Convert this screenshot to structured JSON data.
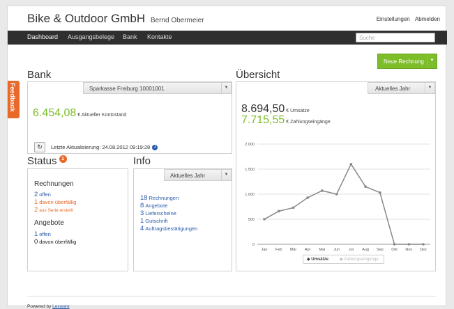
{
  "header": {
    "company": "Bike & Outdoor GmbH",
    "owner": "Bernd Obermeier",
    "settings_label": "Einstellungen",
    "logout_label": "Abmelden"
  },
  "nav": {
    "items": [
      {
        "label": "Dashboard"
      },
      {
        "label": "Ausgangsbelege"
      },
      {
        "label": "Bank"
      },
      {
        "label": "Kontakte"
      }
    ],
    "search_placeholder": "Suche"
  },
  "actions": {
    "new_invoice": "Neue Rechnung"
  },
  "feedback": {
    "label": "Feedback"
  },
  "bank": {
    "title": "Bank",
    "account": "Sparkasse Freiburg 10001001",
    "balance": "6.454,08",
    "balance_label": "€ Aktueller Kontostand",
    "last_update": "Letzte Aktualisierung: 24.08.2012 09:19:28"
  },
  "status": {
    "title": "Status",
    "badge": "1",
    "invoices": {
      "heading": "Rechnungen",
      "open_count": "2",
      "open_label": "offen",
      "overdue_count": "1",
      "overdue_label": "davon überfällig",
      "recurring_count": "2",
      "recurring_label": "aus Serie erstellt"
    },
    "offers": {
      "heading": "Angebote",
      "open_count": "1",
      "open_label": "offen",
      "overdue_count": "0",
      "overdue_label": "davon überfällig"
    }
  },
  "info": {
    "title": "Info",
    "period": "Aktuelles Jahr",
    "items": [
      {
        "count": "18",
        "label": "Rechnungen"
      },
      {
        "count": "8",
        "label": "Angebote"
      },
      {
        "count": "3",
        "label": "Lieferscheine"
      },
      {
        "count": "1",
        "label": "Gutschrift"
      },
      {
        "count": "4",
        "label": "Auftragsbestätigungen"
      }
    ]
  },
  "overview": {
    "title": "Übersicht",
    "period": "Aktuelles Jahr",
    "revenue": "8.694,50",
    "revenue_label": "€ Umsatze",
    "payments": "7.715,55",
    "payments_label": "€ Zahlungseingänge"
  },
  "colors": {
    "accent_green": "#7dbd2a",
    "accent_orange": "#e8692a",
    "link_blue": "#2a5aa8",
    "navbar": "#2f2f2f"
  },
  "chart_data": {
    "type": "line",
    "categories": [
      "Jan",
      "Feb",
      "Mär",
      "Apr",
      "Mai",
      "Jun",
      "Jul",
      "Aug",
      "Sep",
      "Okt",
      "Nov",
      "Dez"
    ],
    "series": [
      {
        "name": "Umsätze",
        "values": [
          500,
          660,
          730,
          930,
          1070,
          1000,
          1600,
          1150,
          1030,
          0,
          0,
          0
        ],
        "color": "#888888"
      },
      {
        "name": "Zahlungseingänge",
        "values": [],
        "color": "#cccccc"
      }
    ],
    "yticks": [
      "0",
      "500",
      "1.000",
      "1.500",
      "2.000"
    ],
    "ylim": [
      0,
      2000
    ],
    "grid": true,
    "legend": "bottom"
  },
  "footer": {
    "powered_by": "Powered by",
    "brand": "Lexware"
  }
}
